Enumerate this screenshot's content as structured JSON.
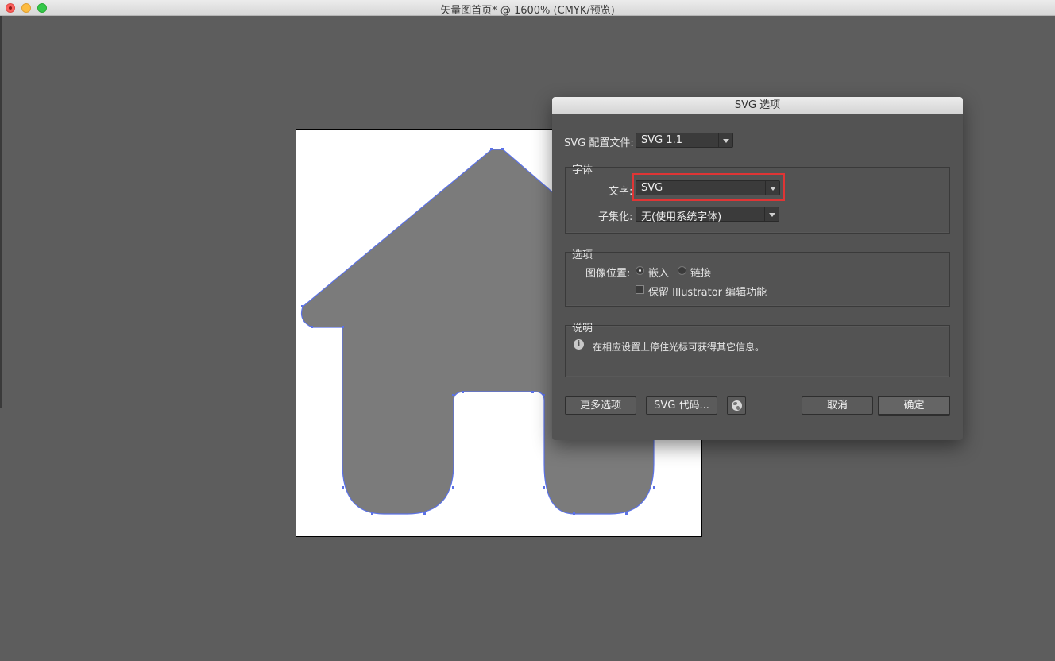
{
  "window": {
    "title": "矢量图首页* @ 1600% (CMYK/预览)"
  },
  "dialog": {
    "title": "SVG 选项",
    "profile_label": "SVG 配置文件:",
    "profile_value": "SVG 1.1",
    "fonts_group_label": "字体",
    "type_label": "文字:",
    "type_value": "SVG",
    "subset_label": "子集化:",
    "subset_value": "无(使用系统字体)",
    "options_group_label": "选项",
    "image_location_label": "图像位置:",
    "embed_label": "嵌入",
    "link_label": "链接",
    "embed_selected": true,
    "preserve_label": "保留 Illustrator 编辑功能",
    "preserve_checked": false,
    "description_group_label": "说明",
    "description_text": "在相应设置上停住光标可获得其它信息。",
    "more_options_label": "更多选项",
    "svg_code_label": "SVG 代码...",
    "cancel_label": "取消",
    "ok_label": "确定"
  },
  "colors": {
    "canvas_bg": "#5d5d5d",
    "dialog_bg": "#535353",
    "house_fill": "#7b7b7b",
    "selection_outline": "#5b72e8",
    "highlight_box": "#e03535"
  },
  "icons": [
    "close-icon",
    "minimize-icon",
    "maximize-icon",
    "info-icon",
    "globe-icon",
    "chevron-down-icon"
  ]
}
